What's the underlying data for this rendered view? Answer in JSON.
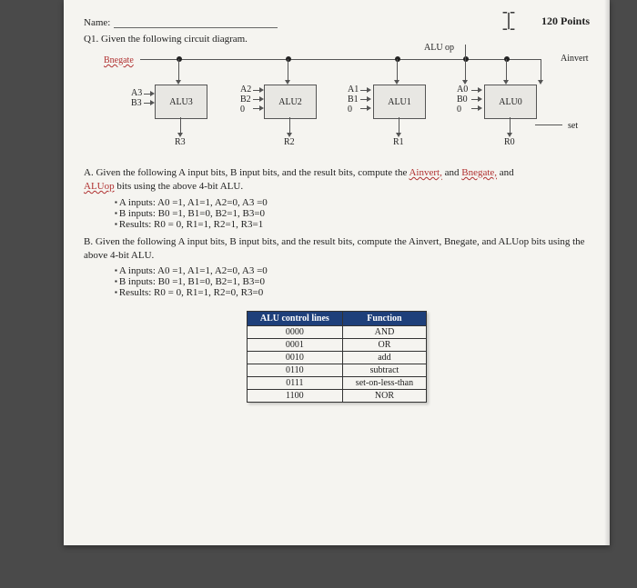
{
  "header": {
    "name_label": "Name:",
    "points": "120 Points"
  },
  "q1": {
    "prompt": "Q1. Given the following circuit diagram."
  },
  "diagram": {
    "bnegate": "Bnegate",
    "aluop": "ALU op",
    "ainvert": "Ainvert",
    "set": "set",
    "alu3": {
      "in": "A3\nB3",
      "box": "ALU3",
      "out": "R3"
    },
    "alu2": {
      "in": "A2\nB2\n0",
      "box": "ALU2",
      "out": "R2"
    },
    "alu1": {
      "in": "A1\nB1\n0",
      "box": "ALU1",
      "out": "R1"
    },
    "alu0": {
      "in": "A0\nB0\n0",
      "box": "ALU0",
      "out": "R0"
    }
  },
  "partA": {
    "text_pre": "A. Given the following A input bits, B input bits, and the result bits, compute the ",
    "red1": "Ainvert,",
    "red2": "Bnegate,",
    "text_mid": " and ",
    "line2_red": "ALUop",
    "line2_rest": " bits using the above 4-bit ALU.",
    "b1": "A inputs: A0 =1, A1=1, A2=0, A3 =0",
    "b2": "B inputs: B0 =1, B1=0, B2=1, B3=0",
    "b3": "Results: R0 = 0, R1=1, R2=1, R3=1"
  },
  "partB": {
    "text": "B. Given the following A input bits, B input bits, and the result bits, compute the Ainvert, Bnegate, and ALUop bits using the above 4-bit ALU.",
    "b1": "A inputs: A0 =1, A1=1, A2=0, A3 =0",
    "b2": "B inputs: B0 =1, B1=0, B2=1, B3=0",
    "b3": "Results: R0 = 0, R1=1, R2=0, R3=0"
  },
  "table": {
    "h1": "ALU control lines",
    "h2": "Function",
    "rows": [
      {
        "c": "0000",
        "f": "AND"
      },
      {
        "c": "0001",
        "f": "OR"
      },
      {
        "c": "0010",
        "f": "add"
      },
      {
        "c": "0110",
        "f": "subtract"
      },
      {
        "c": "0111",
        "f": "set-on-less-than"
      },
      {
        "c": "1100",
        "f": "NOR"
      }
    ]
  }
}
